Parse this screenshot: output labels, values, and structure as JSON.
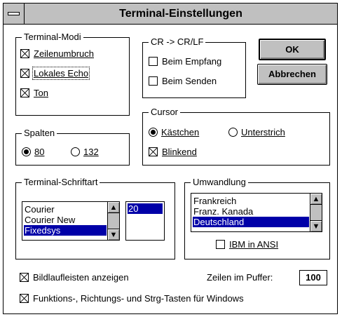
{
  "window": {
    "title": "Terminal-Einstellungen"
  },
  "terminal_modi": {
    "label": "Terminal-Modi",
    "zeilenumbruch": {
      "label": "Zeilenumbruch",
      "checked": true
    },
    "lokales_echo": {
      "label": "Lokales Echo",
      "checked": true
    },
    "ton": {
      "label": "Ton",
      "checked": true
    }
  },
  "cr_lf": {
    "label": "CR -> CR/LF",
    "empfang": {
      "label": "Beim Empfang",
      "checked": false
    },
    "senden": {
      "label": "Beim Senden",
      "checked": false
    }
  },
  "buttons": {
    "ok": "OK",
    "abbrechen": "Abbrechen"
  },
  "spalten": {
    "label": "Spalten",
    "opt80": {
      "label": "80",
      "selected": true
    },
    "opt132": {
      "label": "132",
      "selected": false
    }
  },
  "cursor": {
    "label": "Cursor",
    "kaestchen": {
      "label": "Kästchen",
      "selected": true
    },
    "unterstrich": {
      "label": "Unterstrich",
      "selected": false
    },
    "blinkend": {
      "label": "Blinkend",
      "checked": true
    }
  },
  "schriftart": {
    "label": "Terminal-Schriftart",
    "fonts": [
      {
        "name": "Courier",
        "selected": false
      },
      {
        "name": "Courier New",
        "selected": false
      },
      {
        "name": "Fixedsys",
        "selected": true
      }
    ],
    "sizes": [
      {
        "value": "20",
        "selected": true
      }
    ]
  },
  "umwandlung": {
    "label": "Umwandlung",
    "items": [
      {
        "name": "Frankreich",
        "selected": false
      },
      {
        "name": "Franz. Kanada",
        "selected": false
      },
      {
        "name": "Deutschland",
        "selected": true
      }
    ],
    "ibm_ansi": {
      "label": "IBM in ANSI",
      "checked": false
    }
  },
  "bildlaufleisten": {
    "label": "Bildlaufleisten anzeigen",
    "checked": true
  },
  "puffer": {
    "label": "Zeilen im Puffer:",
    "value": "100"
  },
  "funktionstasten": {
    "label": "Funktions-, Richtungs- und Strg-Tasten für Windows",
    "checked": true
  },
  "icons": {
    "scroll_up": "▲",
    "scroll_down": "▼"
  }
}
